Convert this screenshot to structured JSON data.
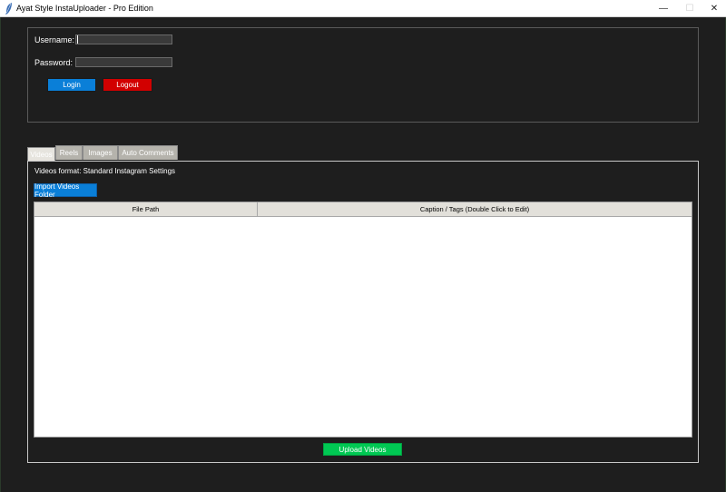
{
  "window": {
    "title": "Ayat Style InstaUploader - Pro Edition",
    "controls": {
      "minimize": "—",
      "maximize": "☐",
      "close": "✕"
    },
    "icon": "feather-icon"
  },
  "login": {
    "username_label": "Username:",
    "username_value": "",
    "password_label": "Password:",
    "password_value": "",
    "login_label": "Login",
    "logout_label": "Logout"
  },
  "tabs": [
    {
      "label": "Videos",
      "active": true
    },
    {
      "label": "Reels",
      "active": false
    },
    {
      "label": "Images",
      "active": false
    },
    {
      "label": "Auto Comments",
      "active": false
    }
  ],
  "videos_tab": {
    "format_text": "Videos format: Standard Instagram Settings",
    "import_label": "Import Videos Folder",
    "columns": [
      "File Path",
      "Caption / Tags (Double Click to Edit)"
    ],
    "rows": [],
    "upload_label": "Upload Videos"
  },
  "colors": {
    "background": "#1e1e1e",
    "login_button": "#0a7fd8",
    "logout_button": "#d20000",
    "upload_button": "#00c853"
  }
}
